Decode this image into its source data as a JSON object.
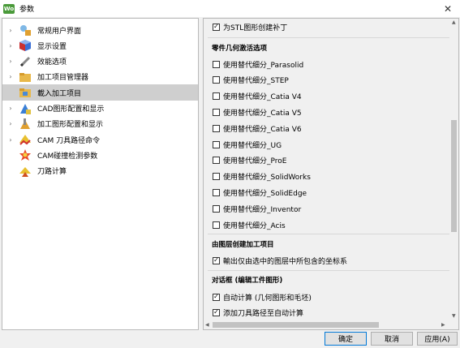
{
  "window": {
    "title": "参数",
    "app_icon_text": "Wo"
  },
  "tree": [
    {
      "label": "常规用户界面",
      "icon": "user-interface-icon",
      "expandable": true,
      "selected": false
    },
    {
      "label": "显示设置",
      "icon": "display-cube-icon",
      "expandable": true,
      "selected": false
    },
    {
      "label": "效能选项",
      "icon": "pencil-icon",
      "expandable": true,
      "selected": false
    },
    {
      "label": "加工项目管理器",
      "icon": "folder-icon",
      "expandable": true,
      "selected": false
    },
    {
      "label": "載入加工项目",
      "icon": "load-folder-icon",
      "expandable": false,
      "selected": true
    },
    {
      "label": "CAD图形配置和显示",
      "icon": "cad-icon",
      "expandable": true,
      "selected": false
    },
    {
      "label": "加工图形配置和显示",
      "icon": "machining-icon",
      "expandable": true,
      "selected": false
    },
    {
      "label": "CAM 刀具路径命令",
      "icon": "toolpath-icon",
      "expandable": true,
      "selected": false
    },
    {
      "label": "CAM碰撞检测参数",
      "icon": "collision-icon",
      "expandable": false,
      "selected": false
    },
    {
      "label": "刀路计算",
      "icon": "calculation-icon",
      "expandable": false,
      "selected": false
    }
  ],
  "options": {
    "top_item": {
      "label": "为STL图形创建补丁",
      "checked": true
    },
    "section1": "零件几何激活选项",
    "alt_items": [
      {
        "label": "使用替代细分_Parasolid",
        "checked": false
      },
      {
        "label": "使用替代细分_STEP",
        "checked": false
      },
      {
        "label": "使用替代细分_Catia V4",
        "checked": false
      },
      {
        "label": "使用替代细分_Catia V5",
        "checked": false
      },
      {
        "label": "使用替代细分_Catia V6",
        "checked": false
      },
      {
        "label": "使用替代细分_UG",
        "checked": false
      },
      {
        "label": "使用替代细分_ProE",
        "checked": false
      },
      {
        "label": "使用替代细分_SolidWorks",
        "checked": false
      },
      {
        "label": "使用替代细分_SolidEdge",
        "checked": false
      },
      {
        "label": "使用替代细分_Inventor",
        "checked": false
      },
      {
        "label": "使用替代细分_Acis",
        "checked": false
      }
    ],
    "section2": "由图层创建加工项目",
    "layer_item": {
      "label": "輸出仅由选中的图层中所包含的坐标系",
      "checked": true
    },
    "section3": "对话框 (编辑工件图形)",
    "dialog_items": [
      {
        "label": "自动计算 (几何图形和毛坯)",
        "checked": true
      },
      {
        "label": "添加刀具路径至自动计算",
        "checked": true
      }
    ]
  },
  "buttons": {
    "ok": "确定",
    "cancel": "取消",
    "apply": "应用(A)"
  },
  "colors": {
    "selection": "#cfcfcf",
    "default_button_border": "#0078d7"
  }
}
